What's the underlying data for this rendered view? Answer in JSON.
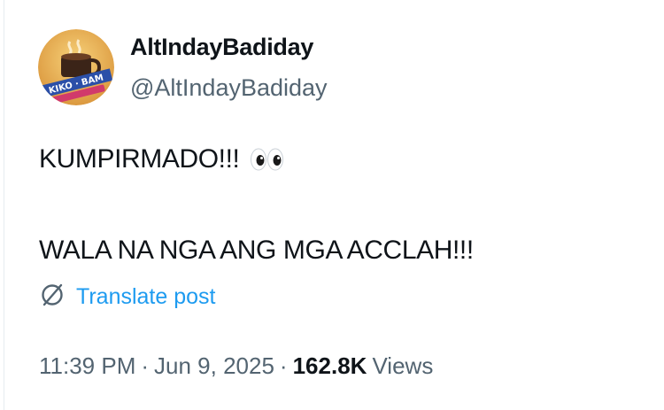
{
  "author": {
    "display_name": "AltIndayBadiday",
    "handle": "@AltIndayBadiday",
    "avatar_text": "KIKO · BAM"
  },
  "post": {
    "line1": "KUMPIRMADO!!!",
    "line1_emoji": "eyes-emoji",
    "line2": "WALA NA NGA ANG MGA ACCLAH!!!"
  },
  "translate": {
    "icon": "translate-globe-icon",
    "label": "Translate post"
  },
  "meta": {
    "time": "11:39 PM",
    "separator": "·",
    "date": "Jun 9, 2025",
    "views_count": "162.8K",
    "views_label": "Views"
  },
  "colors": {
    "text_primary": "#0f1419",
    "text_secondary": "#536471",
    "link": "#1d9bf0"
  }
}
